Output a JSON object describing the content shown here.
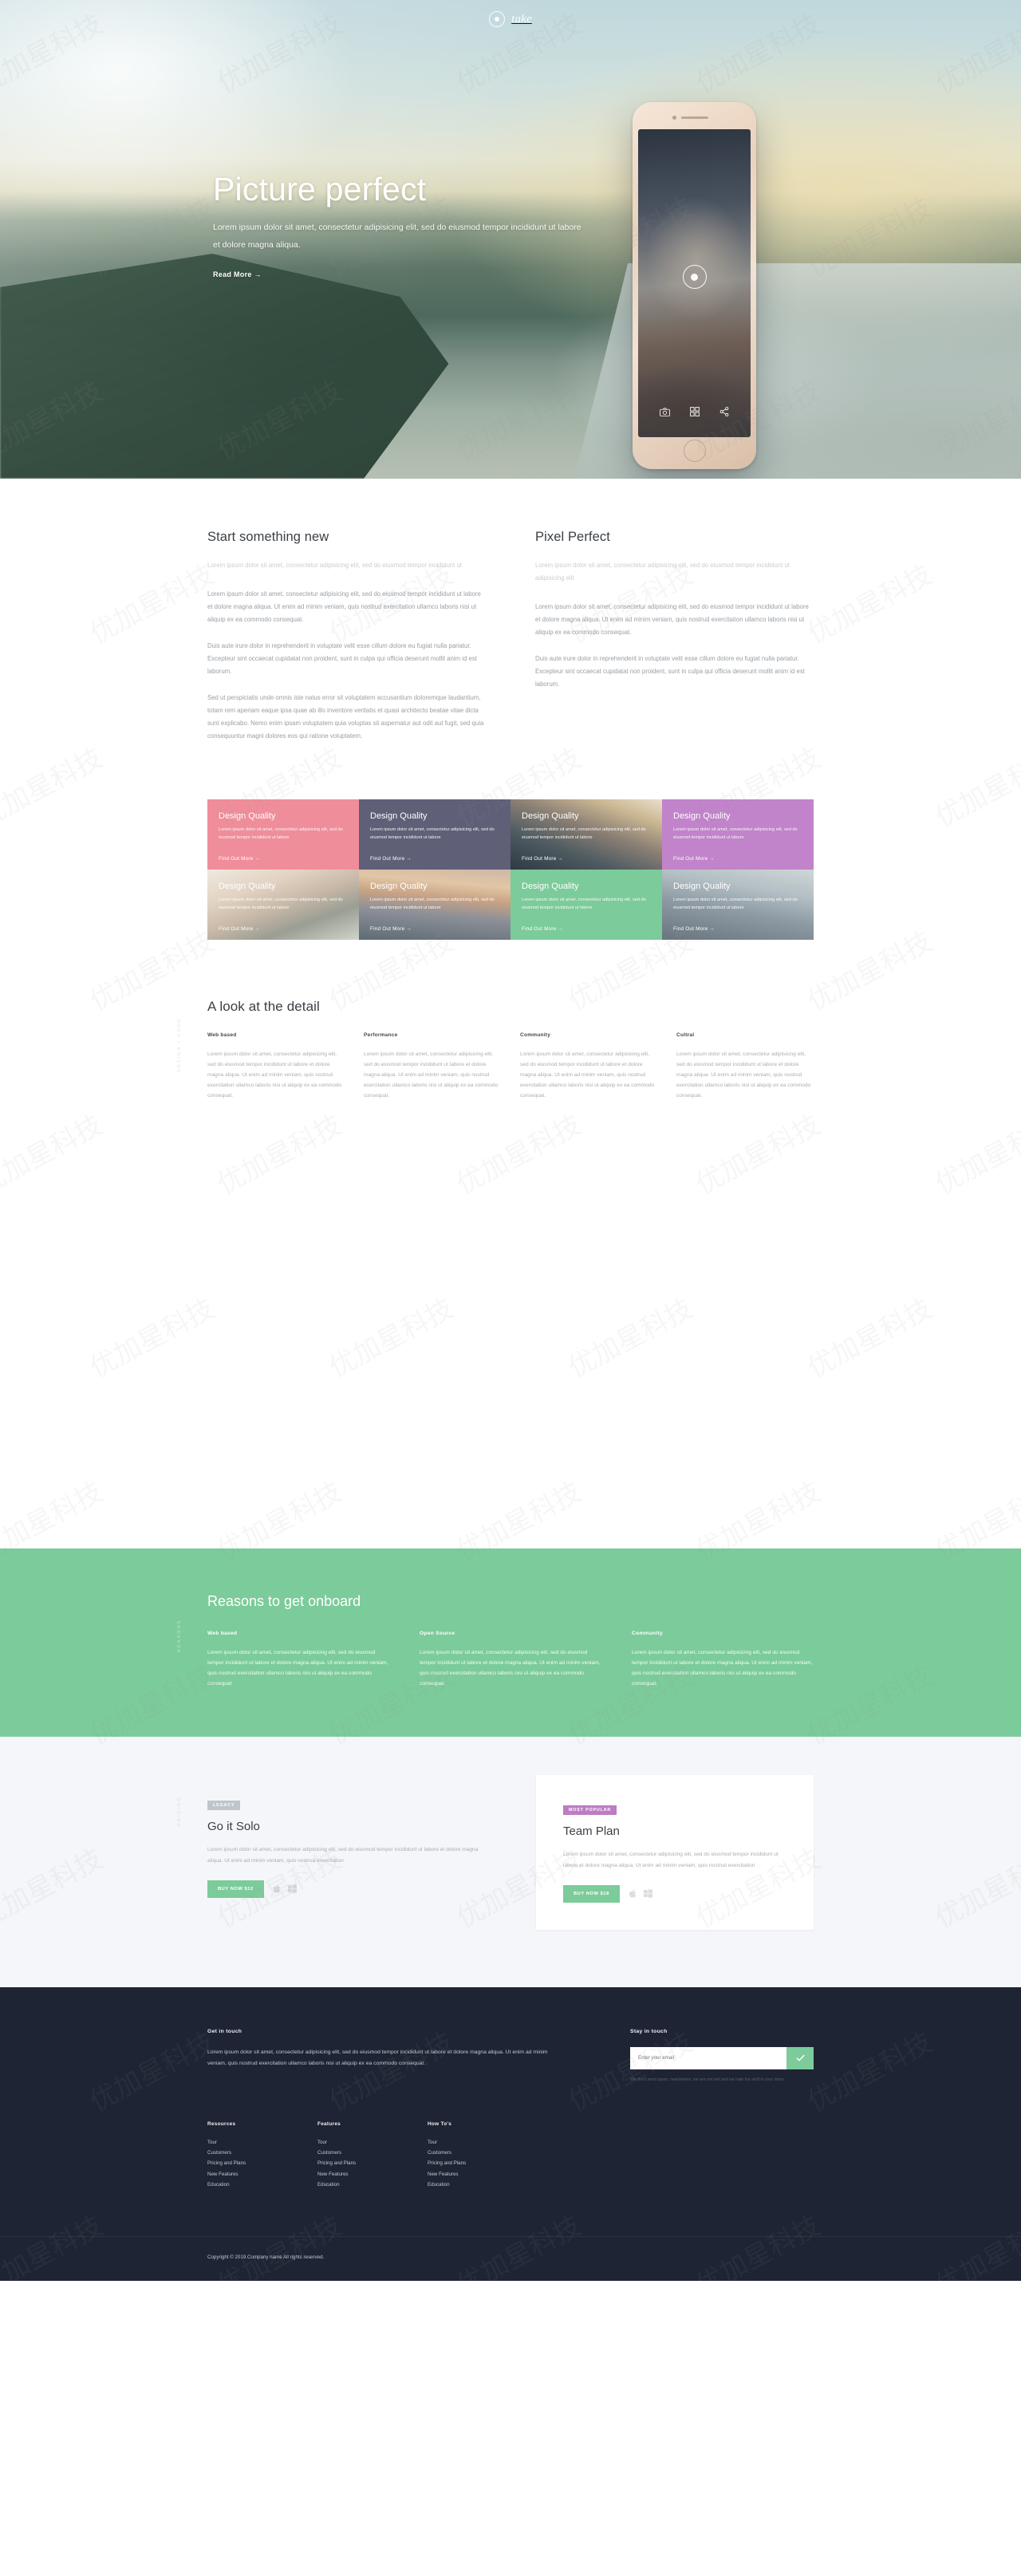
{
  "brand": {
    "name": "take",
    "logo_icon": "camera-aperture-icon"
  },
  "hero": {
    "title": "Picture perfect",
    "subtitle": "Lorem ipsum dolor sit amet, consectetur adipisicing elit, sed do eiusmod tempor incididunt ut labore et dolore magna aliqua.",
    "cta": "Read More →",
    "phone": {
      "shutter_icon": "camera-shutter-icon",
      "toolbar": [
        "camera-icon",
        "grid-icon",
        "share-icon"
      ],
      "home_button": "home-button"
    }
  },
  "intro": {
    "left": {
      "heading": "Start something new",
      "lede": "Lorem ipsum dolor sit amet, consectetur adipisicing elit, sed do eiusmod tempor incididunt ut",
      "p1": "Lorem ipsum dolor sit amet, consectetur adipisicing elit, sed do eiusmod tempor incididunt ut labore et dolore magna aliqua. Ut enim ad minim veniam, quis nostrud exercitation ullamco laboris nisi ut aliquip ex ea commodo consequat.",
      "p2": "Duis aute irure dolor in reprehenderit in voluptate velit esse cillum dolore eu fugiat nulla pariatur. Excepteur sint occaecat cupidatat non proident, sunt in culpa qui officia deserunt mollit anim id est laborum.",
      "p3": "Sed ut perspiciatis unde omnis iste natus error sit voluptatem accusantium doloremque laudantium, totam rem aperiam eaque ipsa quae ab illo inventore veritatis et quasi architecto beatae vitae dicta sunt explicabo. Nemo enim ipsam voluptatem quia voluptas sit aspernatur aut odit aut fugit, sed quia consequuntur magni dolores eos qui ratione voluptatem."
    },
    "right": {
      "heading": "Pixel Perfect",
      "lede": "Lorem ipsum dolor sit amet, consectetur adipisicing elit, sed do eiusmod tempor incididunt ut adipisicing elit",
      "p1": "Lorem ipsum dolor sit amet, consectetur adipisicing elit, sed do eiusmod tempor incididunt ut labore et dolore magna aliqua. Ut enim ad minim veniam, quis nostrud exercitation ullamco laboris nisi ut aliquip ex ea commodo consequat.",
      "p2": "Duis aute irure dolor in reprehenderit in voluptate velit esse cillum dolore eu fugiat nulla pariatur. Excepteur sint occaecat cupidatat non proident, sunt in culpa qui officia deserunt mollit anim id est laborum."
    }
  },
  "tiles": [
    {
      "title": "Design Quality",
      "body": "Lorem ipsum dolor sit amet, consectetur adipisicing elit, sed do eiusmod tempor incididunt ut labore",
      "link": "Find Out More →",
      "bg": "#f08d9a",
      "kind": "solid"
    },
    {
      "title": "Design Quality",
      "body": "Lorem ipsum dolor sit amet, consectetur adipisicing elit, sed do eiusmod tempor incididunt ut labore",
      "link": "Find Out More →",
      "bg": "#5f5f78",
      "kind": "solid"
    },
    {
      "title": "Design Quality",
      "body": "Lorem ipsum dolor sit amet, consectetur adipisicing elit, sed do eiusmod tempor incididunt ut labore",
      "link": "Find Out More →",
      "bg": "",
      "kind": "ph-surf"
    },
    {
      "title": "Design Quality",
      "body": "Lorem ipsum dolor sit amet, consectetur adipisicing elit, sed do eiusmod tempor incididunt ut labore",
      "link": "Find Out More →",
      "bg": "#c183ca",
      "kind": "solid"
    },
    {
      "title": "Design Quality",
      "body": "Lorem ipsum dolor sit amet, consectetur adipisicing elit, sed do eiusmod tempor incididunt ut labore",
      "link": "Find Out More →",
      "bg": "",
      "kind": "ph-couple"
    },
    {
      "title": "Design Quality",
      "body": "Lorem ipsum dolor sit amet, consectetur adipisicing elit, sed do eiusmod tempor incididunt ut labore",
      "link": "Find Out More →",
      "bg": "",
      "kind": "ph-couple2"
    },
    {
      "title": "Design Quality",
      "body": "Lorem ipsum dolor sit amet, consectetur adipisicing elit, sed do eiusmod tempor incididunt ut labore",
      "link": "Find Out More →",
      "bg": "#7ccb9a",
      "kind": "solid"
    },
    {
      "title": "Design Quality",
      "body": "Lorem ipsum dolor sit amet, consectetur adipisicing elit, sed do eiusmod tempor incididunt ut labore",
      "link": "Find Out More →",
      "bg": "",
      "kind": "ph-beach"
    }
  ],
  "detail": {
    "side_label": "DESIGN • CODE",
    "heading": "A look at the detail",
    "columns": [
      {
        "title": "Web based",
        "body": "Lorem ipsum dolor sit amet, consectetur adipisicing elit, sed do eiusmod tempor incididunt ut labore et dolore magna aliqua. Ut enim ad minim veniam, quis nostrud exercitation ullamco laboris nisi ut aliquip ex ea commodo consequat."
      },
      {
        "title": "Performance",
        "body": "Lorem ipsum dolor sit amet, consectetur adipisicing elit, sed do eiusmod tempor incididunt ut labore et dolore magna aliqua. Ut enim ad minim veniam, quis nostrud exercitation ullamco laboris nisi ut aliquip ex ea commodo consequat."
      },
      {
        "title": "Community",
        "body": "Lorem ipsum dolor sit amet, consectetur adipisicing elit, sed do eiusmod tempor incididunt ut labore et dolore magna aliqua. Ut enim ad minim veniam, quis nostrud exercitation ullamco laboris nisi ut aliquip ex ea commodo consequat."
      },
      {
        "title": "Cultral",
        "body": "Lorem ipsum dolor sit amet, consectetur adipisicing elit, sed do eiusmod tempor incididunt ut labore et dolore magna aliqua. Ut enim ad minim veniam, quis nostrud exercitation ullamco laboris nisi ut aliquip ex ea commodo consequat."
      }
    ]
  },
  "band": {
    "side_label": "REASONS",
    "heading": "Reasons to get onboard",
    "bg": "#7ccb9a",
    "columns": [
      {
        "title": "Web based",
        "body": "Lorem ipsum dolor sit amet, consectetur adipisicing elit, sed do eiusmod tempor incididunt ut labore et dolore magna aliqua. Ut enim ad minim veniam, quis nostrud exercitation ullamco laboris nisi ut aliquip ex ea commodo consequat"
      },
      {
        "title": "Open Source",
        "body": "Lorem ipsum dolor sit amet, consectetur adipisicing elit, sed do eiusmod tempor incididunt ut labore et dolore magna aliqua. Ut enim ad minim veniam, quis nostrud exercitation ullamco laboris nisi ut aliquip ex ea commodo consequat."
      },
      {
        "title": "Community",
        "body": "Lorem ipsum dolor sit amet, consectetur adipisicing elit, sed do eiusmod tempor incididunt ut labore et dolore magna aliqua. Ut enim ad minim veniam, quis nostrud exercitation ullamco laboris nisi ut aliquip ex ea commodo consequat."
      }
    ]
  },
  "pricing": {
    "side_label": "PRICING",
    "plans": [
      {
        "badge": "LEGACY",
        "badge_color": "#bfc5cb",
        "title": "Go it Solo",
        "body": "Lorem ipsum dolor sit amet, consectetur adipisicing elit, sed do eiusmod tempor incididunt ut labore et dolore magna aliqua. Ut enim ad minim veniam, quis nostrud exercitation",
        "buy_label": "BUY NOW $12",
        "os_icons": [
          "apple-icon",
          "windows-icon"
        ]
      },
      {
        "badge": "MOST POPULAR",
        "badge_color": "#bd7cc4",
        "title": "Team Plan",
        "body": "Lorem ipsum dolor sit amet, consectetur adipisicing elit, sed do eiusmod tempor incididunt ut labore et dolore magna aliqua. Ut enim ad minim veniam, quis nostrud exercitation",
        "buy_label": "BUY NOW $18",
        "os_icons": [
          "apple-icon",
          "windows-icon"
        ]
      }
    ]
  },
  "footer": {
    "get_in_touch": {
      "title": "Get in touch",
      "body": "Lorem ipsum dolor sit amet, consectetur adipisicing elit, sed do eiusmod tempor incididunt ut labore et dolore magna aliqua. Ut enim ad minim veniam, quis nostrud exercitation ullamco laboris nisi ut aliquip ex ea commodo consequat."
    },
    "stay_in_touch": {
      "title": "Stay in touch",
      "placeholder": "Enter your email",
      "value": "",
      "submit_icon": "check-icon",
      "note": "We don't send spam, newsletters, we are not evil and we hate the stuff in your inbox."
    },
    "link_groups": [
      {
        "title": "Resources",
        "links": [
          "Tour",
          "Customers",
          "Pricing and Plans",
          "New Features",
          "Education"
        ]
      },
      {
        "title": "Features",
        "links": [
          "Tour",
          "Customers",
          "Pricing and Plans",
          "New Features",
          "Education"
        ]
      },
      {
        "title": "How To's",
        "links": [
          "Tour",
          "Customers",
          "Pricing and Plans",
          "New Features",
          "Education"
        ]
      }
    ],
    "copyright": "Copyright © 2019.Company name All rights reserved."
  },
  "watermark": "优加星科技"
}
